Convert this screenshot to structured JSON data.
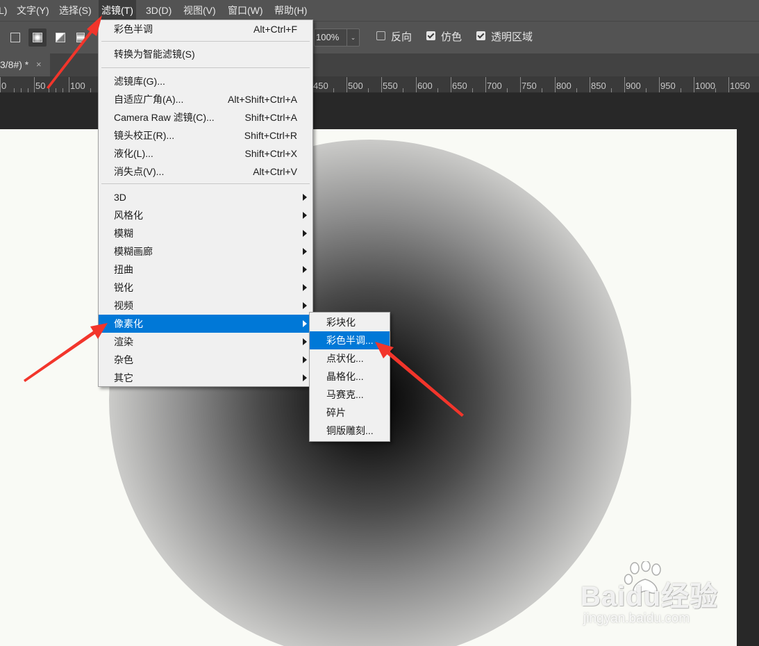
{
  "menubar": {
    "items": [
      "L)",
      "文字(Y)",
      "选择(S)",
      "滤镜(T)",
      "3D(D)",
      "视图(V)",
      "窗口(W)",
      "帮助(H)"
    ],
    "active": "滤镜(T)"
  },
  "options": {
    "opacity_value": "100%",
    "checkboxes": [
      {
        "label": "反向",
        "checked": false
      },
      {
        "label": "仿色",
        "checked": true
      },
      {
        "label": "透明区域",
        "checked": true
      }
    ]
  },
  "tab": {
    "title": "3/8#) *",
    "close": "×"
  },
  "ruler": {
    "labels": [
      "0",
      "50",
      "100",
      "450",
      "500",
      "550",
      "600",
      "650",
      "700",
      "750",
      "800",
      "850",
      "900",
      "950",
      "1000",
      "1050"
    ]
  },
  "filter_menu": {
    "items": [
      {
        "label": "彩色半调",
        "shortcut": "Alt+Ctrl+F"
      },
      {
        "label": "转换为智能滤镜(S)",
        "shortcut": ""
      },
      {
        "label": "滤镜库(G)...",
        "shortcut": ""
      },
      {
        "label": "自适应广角(A)...",
        "shortcut": "Alt+Shift+Ctrl+A"
      },
      {
        "label": "Camera Raw 滤镜(C)...",
        "shortcut": "Shift+Ctrl+A"
      },
      {
        "label": "镜头校正(R)...",
        "shortcut": "Shift+Ctrl+R"
      },
      {
        "label": "液化(L)...",
        "shortcut": "Shift+Ctrl+X"
      },
      {
        "label": "消失点(V)...",
        "shortcut": "Alt+Ctrl+V"
      },
      {
        "label": "3D"
      },
      {
        "label": "风格化"
      },
      {
        "label": "模糊"
      },
      {
        "label": "模糊画廊"
      },
      {
        "label": "扭曲"
      },
      {
        "label": "锐化"
      },
      {
        "label": "视频"
      },
      {
        "label": "像素化"
      },
      {
        "label": "渲染"
      },
      {
        "label": "杂色"
      },
      {
        "label": "其它"
      }
    ],
    "highlighted": "像素化"
  },
  "pixelate_submenu": {
    "items": [
      "彩块化",
      "彩色半调...",
      "点状化...",
      "晶格化...",
      "马赛克...",
      "碎片",
      "铜版雕刻..."
    ],
    "highlighted": "彩色半调..."
  },
  "watermark": {
    "logo": "Baidu经验",
    "url": "jingyan.baidu.com"
  },
  "colors": {
    "highlight": "#0078d7",
    "annotation_arrow": "#f2352b"
  }
}
